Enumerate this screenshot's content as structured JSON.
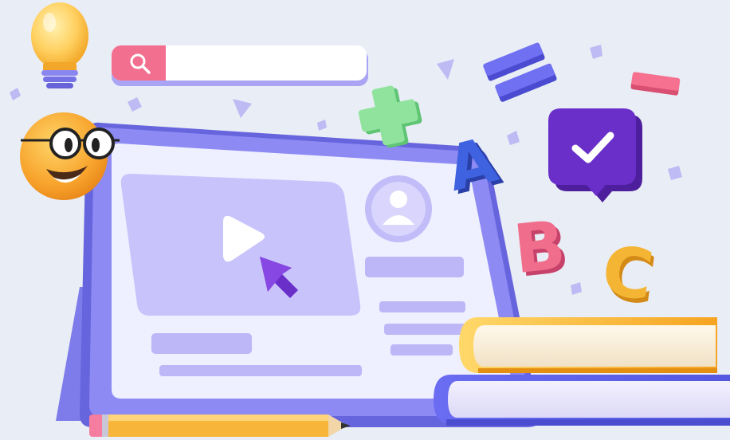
{
  "illustration": {
    "letters": [
      "A",
      "B",
      "C"
    ]
  },
  "colors": {
    "background": "#e9edf6",
    "tablet_frame": "#7b78f0",
    "tablet_screen": "#eef0ff",
    "video_panel": "#c9c3fb",
    "placeholder_bar": "#b8b1f5",
    "accent_purple": "#6a2fc9",
    "accent_pink": "#f06d8c",
    "accent_green": "#7ddc8e",
    "accent_orange": "#f5b534",
    "accent_blue": "#3f62e0"
  },
  "icons": [
    "lightbulb-icon",
    "search-icon",
    "smiley-glasses-icon",
    "play-icon",
    "cursor-arrow-icon",
    "user-avatar-icon",
    "plus-icon",
    "equals-icon",
    "minus-icon",
    "checkmark-chat-icon",
    "pencil-icon",
    "books-icon"
  ]
}
